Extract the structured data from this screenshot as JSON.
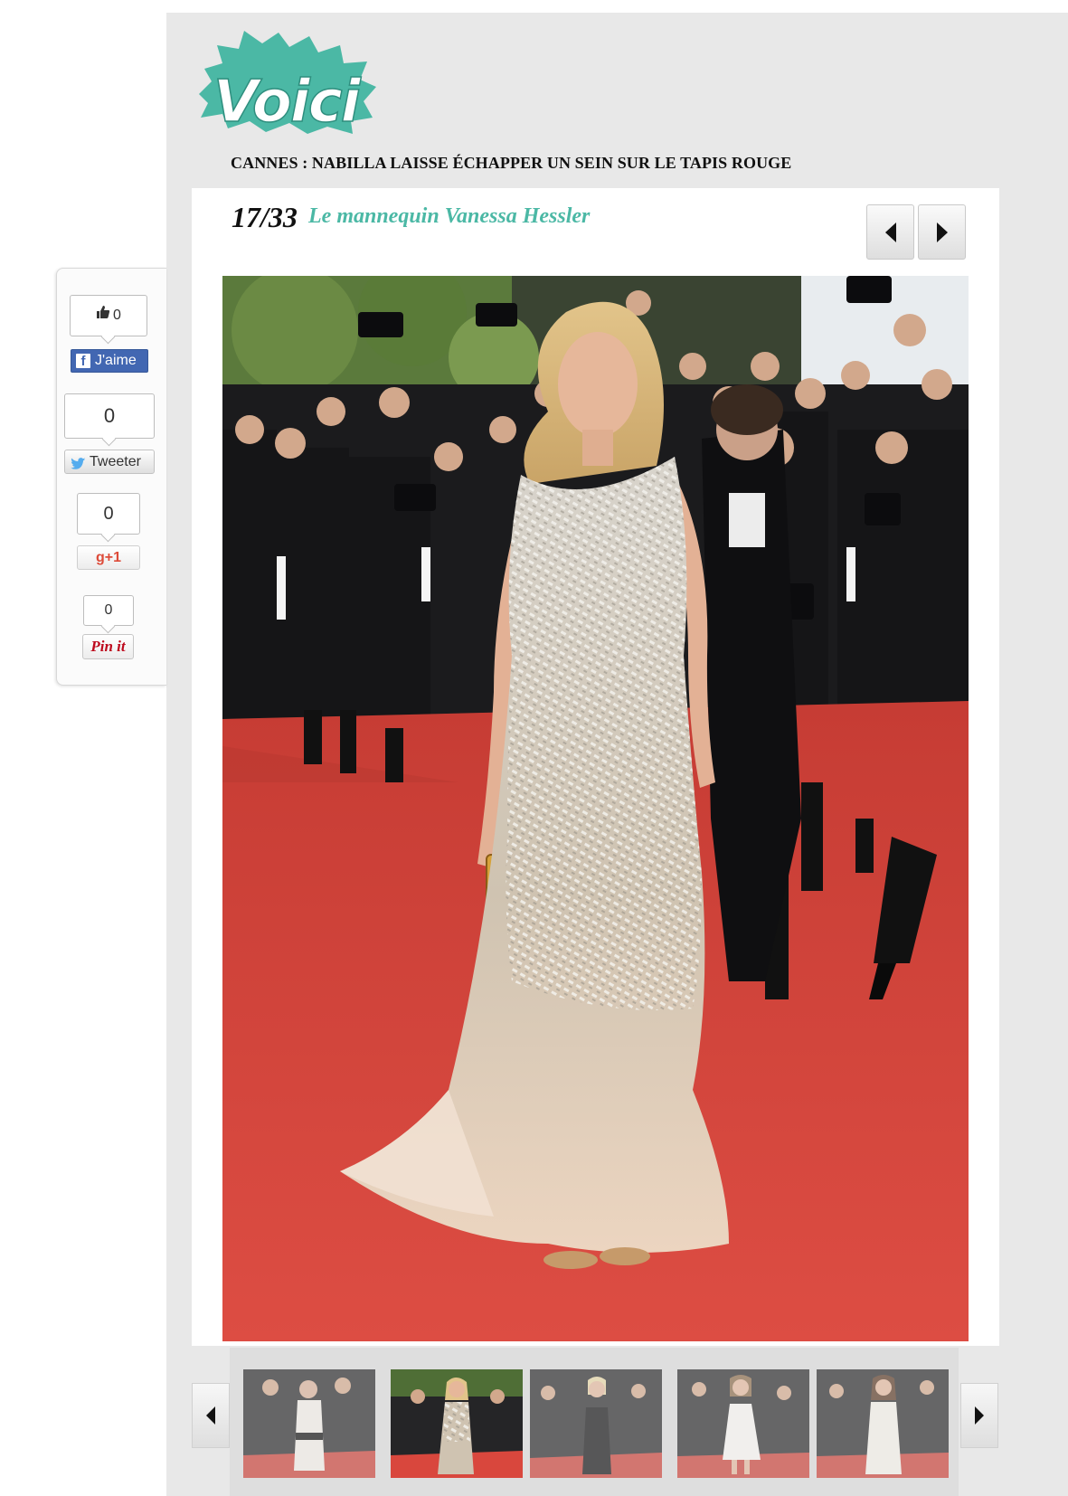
{
  "site": {
    "logo_text": "Voici"
  },
  "article": {
    "headline": "CANNES : NABILLA LAISSE ÉCHAPPER UN SEIN SUR LE TAPIS ROUGE"
  },
  "slideshow": {
    "counter": "17/33",
    "caption": "Le mannequin Vanessa Hessler",
    "prev_icon": "chevron-left-icon",
    "next_icon": "chevron-right-icon"
  },
  "social": {
    "facebook": {
      "count": "0",
      "label": "J'aime"
    },
    "twitter": {
      "count": "0",
      "label": "Tweeter"
    },
    "google": {
      "count": "0",
      "label": "g+1"
    },
    "pinterest": {
      "count": "0",
      "label": "Pin it"
    }
  },
  "thumbnails": {
    "items": [
      {
        "dress": "white-and-black",
        "selected": false
      },
      {
        "dress": "sequin-nude",
        "selected": true
      },
      {
        "dress": "black-strapless",
        "selected": false
      },
      {
        "dress": "white-short",
        "selected": false
      },
      {
        "dress": "white-satin",
        "selected": false
      }
    ]
  },
  "colors": {
    "accent": "#4bb8a5",
    "carpet": "#d9473d",
    "page_bg": "#e8e8e8",
    "facebook": "#4267b2"
  }
}
